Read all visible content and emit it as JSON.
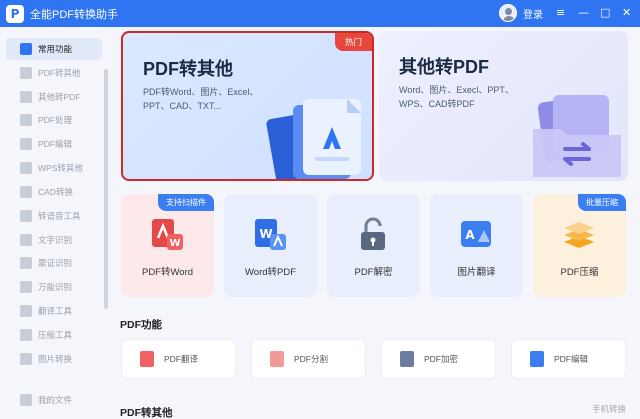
{
  "app": {
    "title": "全能PDF转换助手",
    "logo_letter": "P",
    "login": "登录"
  },
  "window_controls": {
    "menu": "≡",
    "minimize": "—",
    "maximize": "□",
    "close": "✕"
  },
  "sidebar": {
    "items": [
      {
        "label": "常用功能",
        "active": true
      },
      {
        "label": "PDF转其他"
      },
      {
        "label": "其他转PDF"
      },
      {
        "label": "PDF处理"
      },
      {
        "label": "PDF编辑"
      },
      {
        "label": "WPS转其他"
      },
      {
        "label": "CAD转换"
      },
      {
        "label": "转语音工具"
      },
      {
        "label": "文字识别"
      },
      {
        "label": "票证识别"
      },
      {
        "label": "万能识别"
      },
      {
        "label": "翻译工具"
      },
      {
        "label": "压缩工具"
      },
      {
        "label": "图片转换"
      }
    ],
    "bottom_item": "我的文件"
  },
  "hero": [
    {
      "title": "PDF转其他",
      "sub1": "PDF转Word、图片、Excel、",
      "sub2": "PPT、CAD、TXT...",
      "badge": "热门"
    },
    {
      "title": "其他转PDF",
      "sub1": "Word、图片、Execl、PPT、",
      "sub2": "WPS、CAD转PDF"
    }
  ],
  "cards": [
    {
      "label": "PDF转Word",
      "badge": "支持扫描件"
    },
    {
      "label": "Word转PDF"
    },
    {
      "label": "PDF解密"
    },
    {
      "label": "图片翻译"
    },
    {
      "label": "PDF压缩",
      "badge": "批量压缩"
    }
  ],
  "sections": {
    "pdf_functions": "PDF功能",
    "pdf_to_other": "PDF转其他"
  },
  "functions": [
    {
      "label": "PDF翻译"
    },
    {
      "label": "PDF分割"
    },
    {
      "label": "PDF加密"
    },
    {
      "label": "PDF编辑"
    }
  ],
  "phone_convert": "手机转换",
  "colors": {
    "brand": "#2f74f0",
    "hot": "#e8483b",
    "selection_border": "#cc2a2a"
  }
}
